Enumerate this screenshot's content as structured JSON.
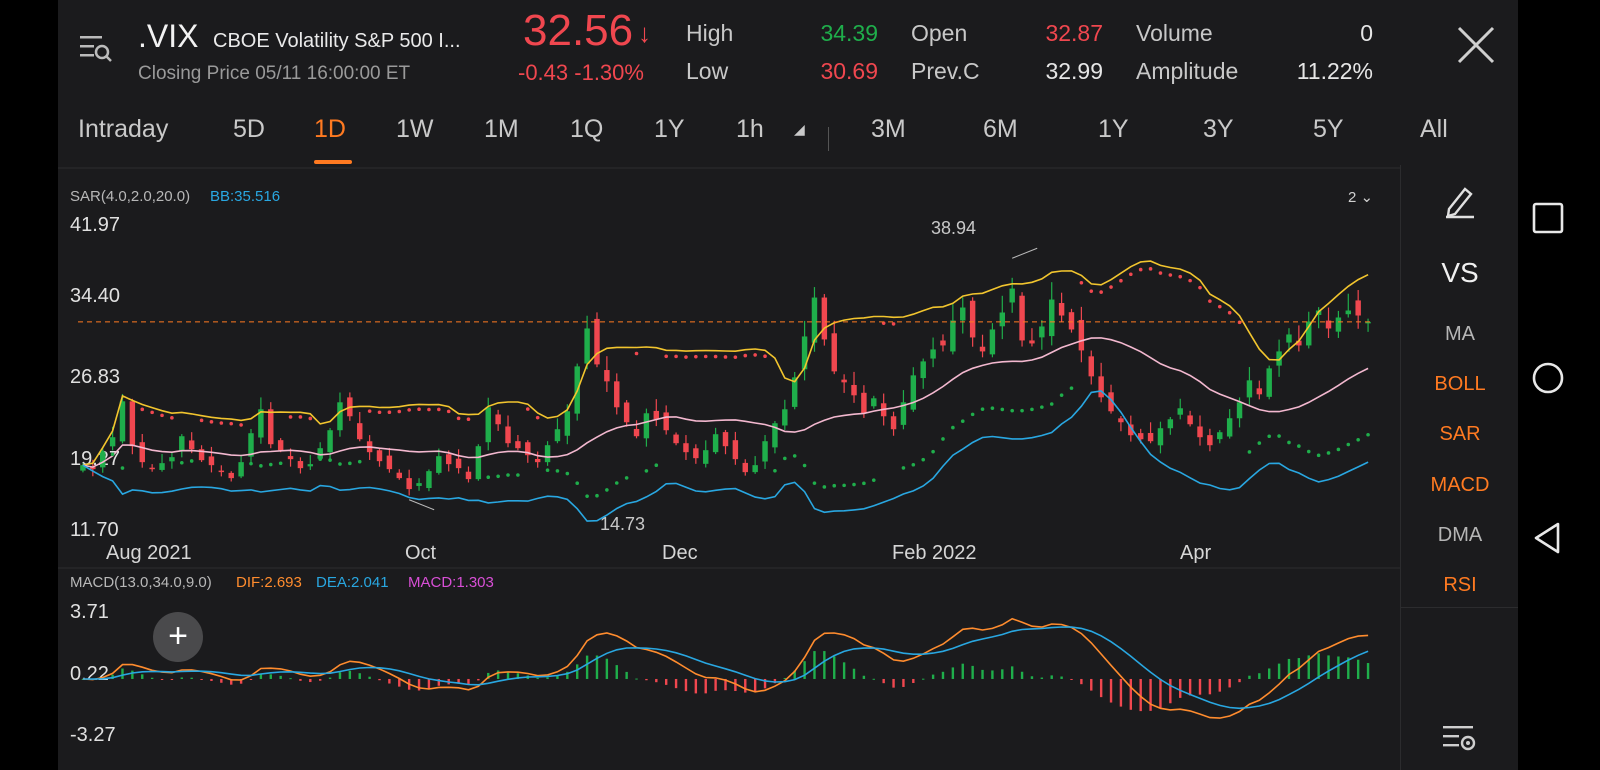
{
  "header": {
    "symbol": ".VIX",
    "name": "CBOE Volatility S&P 500 I...",
    "closing_label": "Closing Price  05/11 16:00:00 ET",
    "price": "32.56",
    "change": "-0.43  -1.30%",
    "stats": {
      "high_label": "High",
      "high": "34.39",
      "low_label": "Low",
      "low": "30.69",
      "open_label": "Open",
      "open": "32.87",
      "prevc_label": "Prev.C",
      "prevc": "32.99",
      "volume_label": "Volume",
      "volume": "0",
      "amplitude_label": "Amplitude",
      "amplitude": "11.22%"
    }
  },
  "periods": [
    "Intraday",
    "5D",
    "1D",
    "1W",
    "1M",
    "1Q",
    "1Y",
    "1h",
    "3M",
    "6M",
    "1Y",
    "3Y",
    "5Y",
    "All"
  ],
  "active_period": "1D",
  "main_chart": {
    "sar_label": "SAR(4.0,2.0,20.0)",
    "bb_label": "BB:35.516",
    "zoom_label": "2",
    "y_ticks": [
      "41.97",
      "34.40",
      "26.83",
      "19.27",
      "11.70"
    ],
    "x_ticks": [
      "Aug 2021",
      "Oct",
      "Dec",
      "Feb 2022",
      "Apr"
    ],
    "max_label": "38.94",
    "min_label": "14.73"
  },
  "macd_chart": {
    "label": "MACD(13.0,34.0,9.0)",
    "dif_label": "DIF:2.693",
    "dea_label": "DEA:2.041",
    "macd_label": "MACD:1.303",
    "y_ticks": [
      "3.71",
      "0.22",
      "-3.27"
    ]
  },
  "side_menu": [
    "MA",
    "BOLL",
    "SAR",
    "MACD",
    "DMA",
    "RSI"
  ],
  "side_active": [
    "BOLL",
    "SAR",
    "MACD",
    "RSI"
  ],
  "side_vs": "VS",
  "plus_label": "+",
  "colors": {
    "up": "#1fae4b",
    "down": "#f0474f",
    "accent": "#ff7a21",
    "bb_upper": "#f2c52e",
    "bb_mid": "#f3b8cf",
    "bb_lower": "#29a7e1",
    "dif": "#ff8c2e",
    "dea": "#29a7e1",
    "macd": "#d84fd6"
  },
  "chart_data": {
    "type": "candlestick",
    "title": ".VIX",
    "ylim": [
      11.7,
      41.97
    ],
    "x_ticks": [
      "Aug 2021",
      "Oct",
      "Dec",
      "Feb 2022",
      "Apr"
    ],
    "last_close": 32.56,
    "period_high": 38.94,
    "period_low": 14.73,
    "closes": [
      18.2,
      17.8,
      19.5,
      21.0,
      24.6,
      20.1,
      18.5,
      17.9,
      18.4,
      19.0,
      21.1,
      19.8,
      18.7,
      18.2,
      17.6,
      16.9,
      18.5,
      21.4,
      23.8,
      20.3,
      19.7,
      18.8,
      17.9,
      18.3,
      19.9,
      21.7,
      24.5,
      23.1,
      20.8,
      19.5,
      18.6,
      17.8,
      16.9,
      15.8,
      16.4,
      17.6,
      19.1,
      18.3,
      17.9,
      16.8,
      20.1,
      24.0,
      22.3,
      20.4,
      19.9,
      19.2,
      18.5,
      20.2,
      21.8,
      23.6,
      28.1,
      31.9,
      28.3,
      26.6,
      24.0,
      22.5,
      21.1,
      23.4,
      22.8,
      21.7,
      20.4,
      19.5,
      18.9,
      19.7,
      21.3,
      20.1,
      18.8,
      17.5,
      18.2,
      20.6,
      22.4,
      23.8,
      27.0,
      31.1,
      35.0,
      30.8,
      27.6,
      26.5,
      25.2,
      23.4,
      24.9,
      23.1,
      21.8,
      24.5,
      27.2,
      28.6,
      29.8,
      30.2,
      32.7,
      34.0,
      31.0,
      29.6,
      31.8,
      33.5,
      35.9,
      30.7,
      30.4,
      32.1,
      34.8,
      33.2,
      31.8,
      29.7,
      27.1,
      25.0,
      23.6,
      22.5,
      21.2,
      20.8,
      20.6,
      21.9,
      22.8,
      23.9,
      22.3,
      21.0,
      20.2,
      21.5,
      22.9,
      24.5,
      26.7,
      25.3,
      27.9,
      29.6,
      31.3,
      30.2,
      32.6,
      33.7,
      31.9,
      33.0,
      33.7,
      33.2,
      32.56
    ],
    "volume": 0
  }
}
